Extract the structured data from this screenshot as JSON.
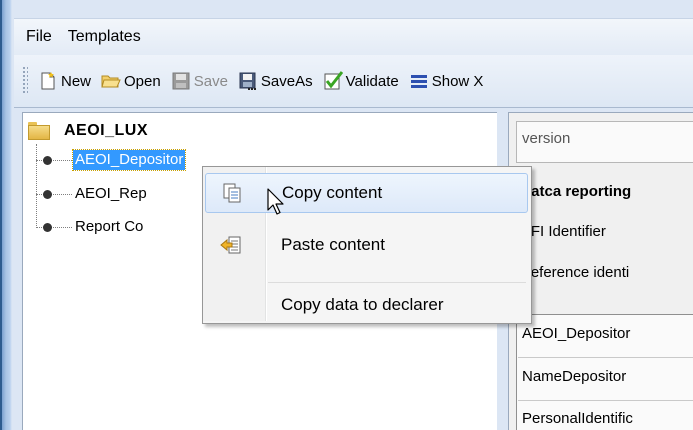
{
  "menubar": {
    "items": [
      "File",
      "Templates"
    ]
  },
  "toolbar": {
    "buttons": [
      {
        "label": "New",
        "icon": "new-document-icon",
        "enabled": true
      },
      {
        "label": "Open",
        "icon": "open-folder-icon",
        "enabled": true
      },
      {
        "label": "Save",
        "icon": "save-disk-icon",
        "enabled": false
      },
      {
        "label": "SaveAs",
        "icon": "save-as-icon",
        "enabled": true
      },
      {
        "label": "Validate",
        "icon": "validate-check-icon",
        "enabled": true
      },
      {
        "label": "Show X",
        "icon": "list-lines-icon",
        "enabled": true
      }
    ]
  },
  "tree": {
    "root": "AEOI_LUX",
    "nodes": [
      {
        "label": "AEOI_Depositor",
        "selected": true
      },
      {
        "label": "AEOI_Rep",
        "selected": false
      },
      {
        "label": "Report Co",
        "selected": false
      }
    ]
  },
  "right_panel": {
    "version_label": "version",
    "section_title": "Fatca reporting",
    "fields": [
      "RFI Identifier",
      "Reference identi"
    ],
    "subsection_title": "AEOI_Depositor",
    "subfields": [
      "NameDepositor",
      "PersonalIdentific"
    ]
  },
  "context_menu": {
    "items": [
      {
        "label": "Copy content",
        "icon": "copy-icon",
        "hover": true
      },
      {
        "label": "Paste content",
        "icon": "paste-icon",
        "hover": false
      },
      {
        "label": "Copy data to declarer",
        "icon": "",
        "hover": false
      }
    ]
  },
  "colors": {
    "selection": "#3399ff",
    "frame": "#dce6f4",
    "menu_hover": "#dde9f9"
  }
}
